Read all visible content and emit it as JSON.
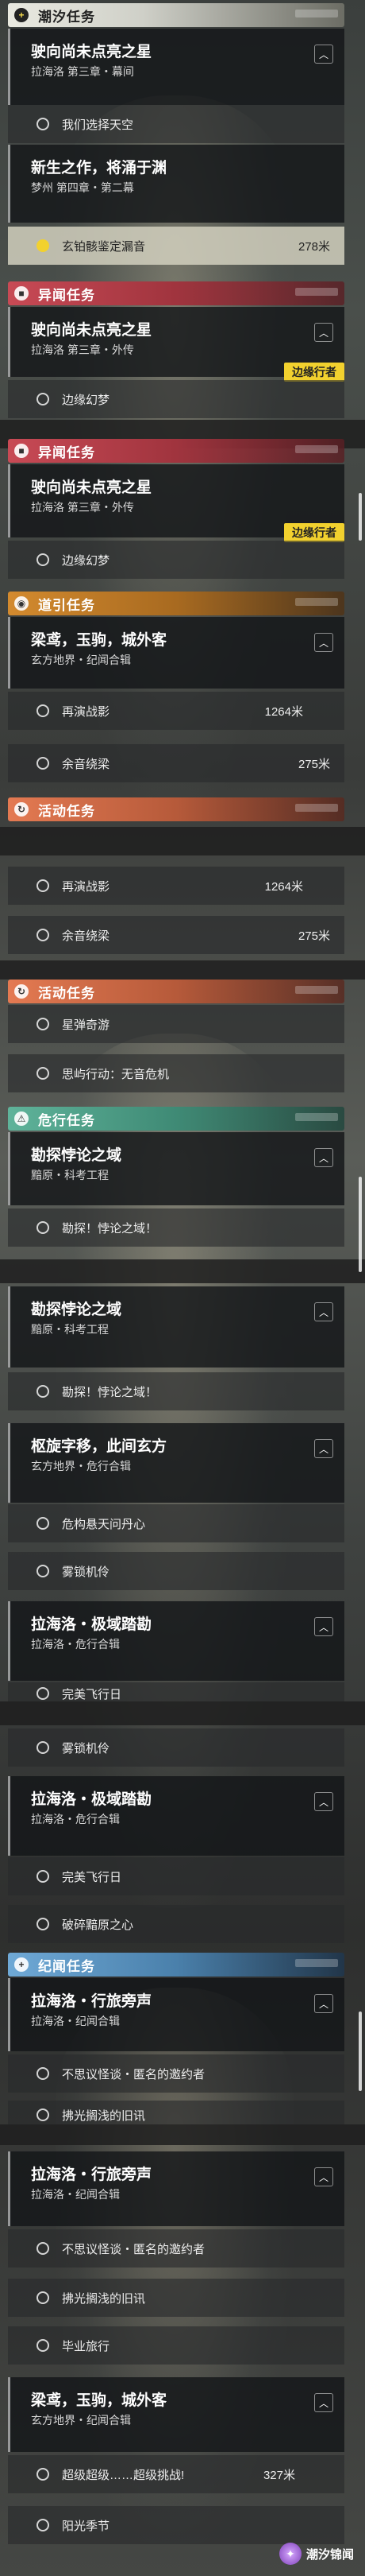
{
  "sections": {
    "tide": "潮汐任务",
    "anomaly": "异闻任务",
    "guide": "道引任务",
    "event": "活动任务",
    "danger": "危行任务",
    "record": "纪闻任务"
  },
  "section_icons": {
    "tide": "+",
    "anomaly": "■",
    "guide": "◉",
    "event": "↻",
    "danger": "⚠",
    "record": "+"
  },
  "tags": {
    "edge_walker": "边缘行者"
  },
  "quests": {
    "q1": {
      "title": "驶向尚未点亮之星",
      "sub": "拉海洛 第三章・幕间"
    },
    "q2": {
      "title": "新生之作，将涌于渊",
      "sub": "梦州 第四章・第二幕"
    },
    "q3": {
      "title": "驶向尚未点亮之星",
      "sub": "拉海洛 第三章・外传"
    },
    "q4": {
      "title": "梁鸢，玉驹，城外客",
      "sub": "玄方地界・纪闻合辑"
    },
    "q5": {
      "title": "勘探悖论之域",
      "sub": "黯原・科考工程"
    },
    "q6": {
      "title": "枢旋字移，此间玄方",
      "sub": "玄方地界・危行合辑"
    },
    "q7": {
      "title": "拉海洛・极域踏勘",
      "sub": "拉海洛・危行合辑"
    },
    "q8": {
      "title": "拉海洛・行旅旁声",
      "sub": "拉海洛・纪闻合辑"
    }
  },
  "steps": {
    "choose_sky": "我们选择天空",
    "xuanming": "玄铂骸鉴定漏音",
    "xuanming_dist": "278米",
    "edge_dream": "边缘幻梦",
    "replay_battle": "再演战影",
    "replay_dist": "1264米",
    "yuyin": "余音绕梁",
    "yuyin_dist": "275米",
    "star_pop": "星弹奇游",
    "mind_action": "思屿行动：无音危机",
    "explore": "勘探！悖论之域！",
    "danger_sky": "危构悬天问丹心",
    "fog_lock": "雾锁机伶",
    "perfect_flight": "完美飞行日",
    "break_heart": "破碎黯原之心",
    "invite": "不思议怪谈・匿名的邀约者",
    "old_news": "拂光搁浅的旧讯",
    "graduation": "毕业旅行",
    "super_challenge": "超级超级……超级挑战!",
    "super_dist": "327米",
    "sun_season": "阳光季节"
  },
  "watermark": {
    "icon": "✦",
    "text": "潮汐锦闻"
  }
}
